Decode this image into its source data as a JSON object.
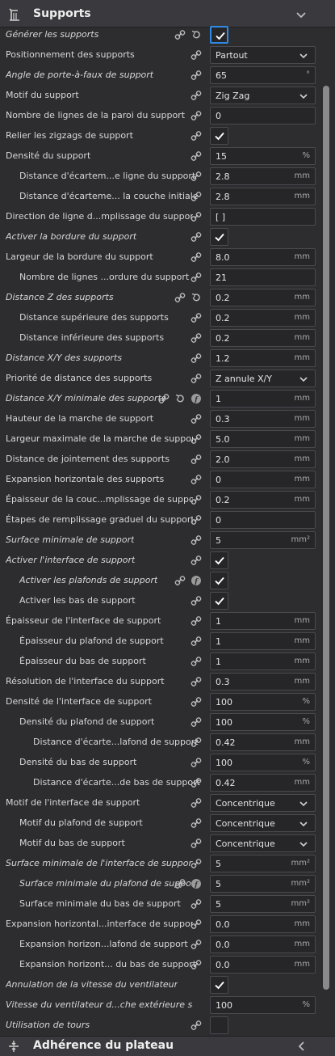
{
  "header": {
    "title": "Supports"
  },
  "footer": {
    "title": "Adhérence du plateau"
  },
  "rows": [
    {
      "label": "Générer les supports",
      "italic": true,
      "indent": 0,
      "icons": [
        "link",
        "reset"
      ],
      "control": "checkbox",
      "checked": true,
      "highlight": true
    },
    {
      "label": "Positionnement des supports",
      "italic": false,
      "indent": 0,
      "icons": [
        "link"
      ],
      "control": "select",
      "value": "Partout"
    },
    {
      "label": "Angle de porte-à-faux de support",
      "italic": true,
      "indent": 0,
      "icons": [
        "link"
      ],
      "control": "number",
      "value": "65",
      "unit": "°"
    },
    {
      "label": "Motif du support",
      "italic": false,
      "indent": 0,
      "icons": [
        "link"
      ],
      "control": "select",
      "value": "Zig Zag"
    },
    {
      "label": "Nombre de lignes de la paroi du support",
      "italic": false,
      "indent": 0,
      "icons": [
        "link"
      ],
      "control": "number",
      "value": "0",
      "unit": ""
    },
    {
      "label": "Relier les zigzags de support",
      "italic": false,
      "indent": 0,
      "icons": [
        "link"
      ],
      "control": "checkbox",
      "checked": true
    },
    {
      "label": "Densité du support",
      "italic": false,
      "indent": 0,
      "icons": [
        "link"
      ],
      "control": "number",
      "value": "15",
      "unit": "%"
    },
    {
      "label": "Distance d'écartem...e ligne du support",
      "italic": false,
      "indent": 1,
      "icons": [
        "link"
      ],
      "control": "number",
      "value": "2.8",
      "unit": "mm"
    },
    {
      "label": "Distance d'écarteme... la couche initiale",
      "italic": false,
      "indent": 1,
      "icons": [
        "link"
      ],
      "control": "number",
      "value": "2.8",
      "unit": "mm"
    },
    {
      "label": "Direction de ligne d...mplissage du support",
      "italic": false,
      "indent": 0,
      "icons": [
        "link"
      ],
      "control": "number",
      "value": "[ ]",
      "unit": ""
    },
    {
      "label": "Activer la bordure du support",
      "italic": true,
      "indent": 0,
      "icons": [
        "link"
      ],
      "control": "checkbox",
      "checked": true
    },
    {
      "label": "Largeur de la bordure du support",
      "italic": false,
      "indent": 0,
      "icons": [
        "link"
      ],
      "control": "number",
      "value": "8.0",
      "unit": "mm"
    },
    {
      "label": "Nombre de lignes ...ordure du support",
      "italic": false,
      "indent": 1,
      "icons": [
        "link"
      ],
      "control": "number",
      "value": "21",
      "unit": ""
    },
    {
      "label": "Distance Z des supports",
      "italic": true,
      "indent": 0,
      "icons": [
        "link",
        "reset"
      ],
      "control": "number",
      "value": "0.2",
      "unit": "mm"
    },
    {
      "label": "Distance supérieure des supports",
      "italic": false,
      "indent": 1,
      "icons": [
        "link"
      ],
      "control": "number",
      "value": "0.2",
      "unit": "mm"
    },
    {
      "label": "Distance inférieure des supports",
      "italic": false,
      "indent": 1,
      "icons": [
        "link"
      ],
      "control": "number",
      "value": "0.2",
      "unit": "mm"
    },
    {
      "label": "Distance X/Y des supports",
      "italic": true,
      "indent": 0,
      "icons": [
        "link"
      ],
      "control": "number",
      "value": "1.2",
      "unit": "mm"
    },
    {
      "label": "Priorité de distance des supports",
      "italic": false,
      "indent": 0,
      "icons": [
        "link"
      ],
      "control": "select",
      "value": "Z annule X/Y"
    },
    {
      "label": "Distance X/Y minimale des supports",
      "italic": true,
      "indent": 0,
      "icons": [
        "link",
        "reset",
        "fx"
      ],
      "control": "number",
      "value": "1",
      "unit": "mm"
    },
    {
      "label": "Hauteur de la marche de support",
      "italic": false,
      "indent": 0,
      "icons": [
        "link"
      ],
      "control": "number",
      "value": "0.3",
      "unit": "mm"
    },
    {
      "label": "Largeur maximale de la marche de support",
      "italic": false,
      "indent": 0,
      "icons": [
        "link"
      ],
      "control": "number",
      "value": "5.0",
      "unit": "mm"
    },
    {
      "label": "Distance de jointement des supports",
      "italic": false,
      "indent": 0,
      "icons": [
        "link"
      ],
      "control": "number",
      "value": "2.0",
      "unit": "mm"
    },
    {
      "label": "Expansion horizontale des supports",
      "italic": false,
      "indent": 0,
      "icons": [
        "link"
      ],
      "control": "number",
      "value": "0",
      "unit": "mm"
    },
    {
      "label": "Épaisseur de la couc...mplissage de support",
      "italic": false,
      "indent": 0,
      "icons": [
        "link"
      ],
      "control": "number",
      "value": "0.2",
      "unit": "mm"
    },
    {
      "label": "Étapes de remplissage graduel du support",
      "italic": false,
      "indent": 0,
      "icons": [
        "link"
      ],
      "control": "number",
      "value": "0",
      "unit": ""
    },
    {
      "label": "Surface minimale de support",
      "italic": true,
      "indent": 0,
      "icons": [
        "link"
      ],
      "control": "number",
      "value": "5",
      "unit": "mm²"
    },
    {
      "label": "Activer l'interface de support",
      "italic": true,
      "indent": 0,
      "icons": [
        "link"
      ],
      "control": "checkbox",
      "checked": true
    },
    {
      "label": "Activer les plafonds de support",
      "italic": true,
      "indent": 1,
      "icons": [
        "link",
        "fx"
      ],
      "control": "checkbox",
      "checked": true
    },
    {
      "label": "Activer les bas de support",
      "italic": false,
      "indent": 1,
      "icons": [
        "link"
      ],
      "control": "checkbox",
      "checked": true
    },
    {
      "label": "Épaisseur de l'interface de support",
      "italic": false,
      "indent": 0,
      "icons": [
        "link"
      ],
      "control": "number",
      "value": "1",
      "unit": "mm"
    },
    {
      "label": "Épaisseur du plafond de support",
      "italic": false,
      "indent": 1,
      "icons": [
        "link"
      ],
      "control": "number",
      "value": "1",
      "unit": "mm"
    },
    {
      "label": "Épaisseur du bas de support",
      "italic": false,
      "indent": 1,
      "icons": [
        "link"
      ],
      "control": "number",
      "value": "1",
      "unit": "mm"
    },
    {
      "label": "Résolution de l'interface du support",
      "italic": false,
      "indent": 0,
      "icons": [
        "link"
      ],
      "control": "number",
      "value": "0.3",
      "unit": "mm"
    },
    {
      "label": "Densité de l'interface de support",
      "italic": false,
      "indent": 0,
      "icons": [
        "link"
      ],
      "control": "number",
      "value": "100",
      "unit": "%"
    },
    {
      "label": "Densité du plafond de support",
      "italic": false,
      "indent": 1,
      "icons": [
        "link"
      ],
      "control": "number",
      "value": "100",
      "unit": "%"
    },
    {
      "label": "Distance d'écarte...lafond de support",
      "italic": false,
      "indent": 2,
      "icons": [
        "link"
      ],
      "control": "number",
      "value": "0.42",
      "unit": "mm"
    },
    {
      "label": "Densité du bas de support",
      "italic": false,
      "indent": 1,
      "icons": [
        "link"
      ],
      "control": "number",
      "value": "100",
      "unit": "%"
    },
    {
      "label": "Distance d'écarte...de bas de support",
      "italic": false,
      "indent": 2,
      "icons": [
        "link"
      ],
      "control": "number",
      "value": "0.42",
      "unit": "mm"
    },
    {
      "label": "Motif de l'interface de support",
      "italic": false,
      "indent": 0,
      "icons": [
        "link"
      ],
      "control": "select",
      "value": "Concentrique"
    },
    {
      "label": "Motif du plafond de support",
      "italic": false,
      "indent": 1,
      "icons": [
        "link"
      ],
      "control": "select",
      "value": "Concentrique"
    },
    {
      "label": "Motif du bas de support",
      "italic": false,
      "indent": 1,
      "icons": [
        "link"
      ],
      "control": "select",
      "value": "Concentrique"
    },
    {
      "label": "Surface minimale de l'interface de support",
      "italic": true,
      "indent": 0,
      "icons": [
        "link"
      ],
      "control": "number",
      "value": "5",
      "unit": "mm²"
    },
    {
      "label": "Surface minimale du plafond de support",
      "italic": true,
      "indent": 1,
      "icons": [
        "link",
        "fx"
      ],
      "control": "number",
      "value": "5",
      "unit": "mm²"
    },
    {
      "label": "Surface minimale du bas de support",
      "italic": false,
      "indent": 1,
      "icons": [
        "link"
      ],
      "control": "number",
      "value": "5",
      "unit": "mm²"
    },
    {
      "label": "Expansion horizontal...interface de support",
      "italic": false,
      "indent": 0,
      "icons": [
        "link"
      ],
      "control": "number",
      "value": "0.0",
      "unit": "mm"
    },
    {
      "label": "Expansion horizon...lafond de support",
      "italic": false,
      "indent": 1,
      "icons": [
        "link"
      ],
      "control": "number",
      "value": "0.0",
      "unit": "mm"
    },
    {
      "label": "Expansion horizont... du bas de support",
      "italic": false,
      "indent": 1,
      "icons": [
        "link"
      ],
      "control": "number",
      "value": "0.0",
      "unit": "mm"
    },
    {
      "label": "Annulation de la vitesse du ventilateur",
      "italic": true,
      "indent": 0,
      "icons": [],
      "control": "checkbox",
      "checked": true
    },
    {
      "label": "Vitesse du ventilateur d...che extérieure supportée",
      "italic": true,
      "indent": 0,
      "icons": [],
      "control": "number",
      "value": "100",
      "unit": "%"
    },
    {
      "label": "Utilisation de tours",
      "italic": true,
      "indent": 0,
      "icons": [
        "link"
      ],
      "control": "checkbox",
      "checked": false
    }
  ]
}
